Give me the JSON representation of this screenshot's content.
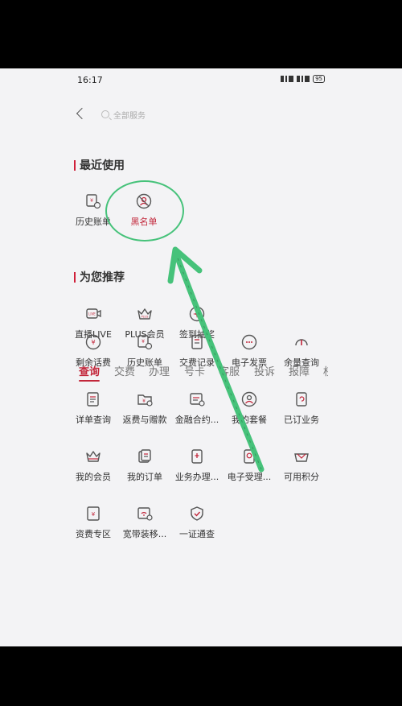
{
  "status": {
    "time": "16:17",
    "net": "3.90\nKB/S",
    "battery": "95"
  },
  "header": {
    "search_placeholder": "全部服务"
  },
  "recent": {
    "title": "最近使用",
    "items": [
      {
        "label": "历史账单",
        "icon": "bill-history-icon"
      },
      {
        "label": "黑名单",
        "icon": "blacklist-icon"
      }
    ]
  },
  "recommend": {
    "title": "为您推荐",
    "items": [
      {
        "label": "直播LIVE",
        "icon": "live-icon"
      },
      {
        "label": "PLUS会员",
        "icon": "crown-icon"
      },
      {
        "label": "签到抽奖",
        "icon": "checkin-icon"
      }
    ]
  },
  "tabs": [
    "查询",
    "交费",
    "办理",
    "号卡",
    "客服",
    "投诉",
    "报障",
    "权"
  ],
  "services": [
    {
      "label": "剩余话费",
      "icon": "yuan-circle-icon"
    },
    {
      "label": "历史账单",
      "icon": "bill-history-icon"
    },
    {
      "label": "交费记录",
      "icon": "payment-record-icon"
    },
    {
      "label": "电子发票",
      "icon": "e-invoice-icon"
    },
    {
      "label": "余量查询",
      "icon": "gauge-icon"
    },
    {
      "label": "详单查询",
      "icon": "detail-list-icon"
    },
    {
      "label": "返费与赠款",
      "icon": "rebate-folder-icon"
    },
    {
      "label": "金融合约...",
      "icon": "finance-contract-icon"
    },
    {
      "label": "我的套餐",
      "icon": "my-plan-icon"
    },
    {
      "label": "已订业务",
      "icon": "subscribed-icon"
    },
    {
      "label": "我的会员",
      "icon": "crown-icon"
    },
    {
      "label": "我的订单",
      "icon": "orders-icon"
    },
    {
      "label": "业务办理...",
      "icon": "business-icon"
    },
    {
      "label": "电子受理...",
      "icon": "e-accept-icon"
    },
    {
      "label": "可用积分",
      "icon": "points-icon"
    },
    {
      "label": "资费专区",
      "icon": "tariff-icon"
    },
    {
      "label": "宽带装移...",
      "icon": "broadband-icon"
    },
    {
      "label": "一证通查",
      "icon": "shield-check-icon"
    }
  ],
  "colors": {
    "accent": "#c2263a",
    "annotation": "#46c27a",
    "background": "#f3f3f5"
  }
}
